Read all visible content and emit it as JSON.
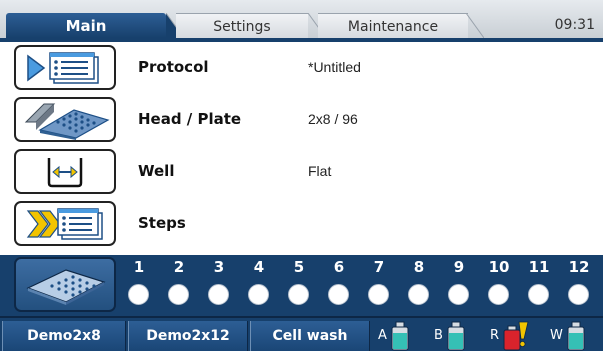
{
  "tabs": [
    {
      "label": "Main",
      "active": true
    },
    {
      "label": "Settings",
      "active": false
    },
    {
      "label": "Maintenance",
      "active": false
    }
  ],
  "clock": "09:31",
  "rows": [
    {
      "label": "Protocol",
      "value": "*Untitled",
      "icon": "protocol-list-icon"
    },
    {
      "label": "Head / Plate",
      "value": "2x8 / 96",
      "icon": "head-plate-icon"
    },
    {
      "label": "Well",
      "value": "Flat",
      "icon": "flat-well-icon"
    },
    {
      "label": "Steps",
      "value": "",
      "icon": "steps-list-icon"
    }
  ],
  "columns": [
    "1",
    "2",
    "3",
    "4",
    "5",
    "6",
    "7",
    "8",
    "9",
    "10",
    "11",
    "12"
  ],
  "bottom_buttons": [
    "Demo2x8",
    "Demo2x12",
    "Cell wash"
  ],
  "bottles": [
    {
      "letter": "A",
      "status": "ok",
      "color": "#35c0b5"
    },
    {
      "letter": "B",
      "status": "ok",
      "color": "#35c0b5"
    },
    {
      "letter": "R",
      "status": "warning",
      "color": "#d9232c"
    },
    {
      "letter": "W",
      "status": "ok",
      "color": "#35c0b5"
    }
  ],
  "colors": {
    "navy": "#17406c",
    "accent_blue": "#2d5e95",
    "warning": "#f2c400"
  }
}
